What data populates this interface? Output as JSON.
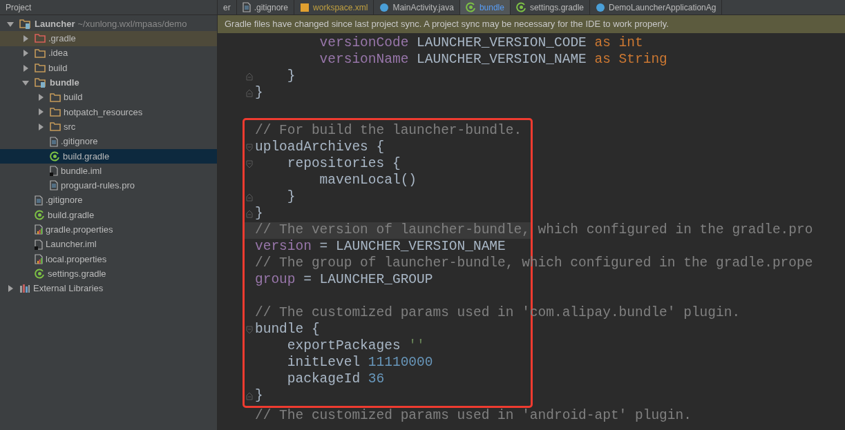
{
  "project_header": {
    "title": "Project"
  },
  "tabs": [
    {
      "label": "er",
      "kind": "none",
      "selected": false
    },
    {
      "label": ".gitignore",
      "kind": "text",
      "selected": false
    },
    {
      "label": "workspace.xml",
      "kind": "xml",
      "selected": false
    },
    {
      "label": "MainActivity.java",
      "kind": "class",
      "selected": false
    },
    {
      "label": "bundle",
      "kind": "gradle",
      "selected": true
    },
    {
      "label": "settings.gradle",
      "kind": "gradle",
      "selected": false
    },
    {
      "label": "DemoLauncherApplicationAg",
      "kind": "class",
      "selected": false
    }
  ],
  "sidebar": {
    "tree": [
      {
        "label": "Launcher",
        "path": "~/xunlong.wxl/mpaas/demo",
        "kind": "module",
        "expanded": true,
        "selected": false,
        "highlighted": false,
        "children": [
          {
            "label": ".gradle",
            "kind": "excluded-folder",
            "expanded": false,
            "selected": false,
            "highlighted": true
          },
          {
            "label": ".idea",
            "kind": "folder",
            "expanded": false,
            "selected": false,
            "highlighted": false
          },
          {
            "label": "build",
            "kind": "folder",
            "expanded": false,
            "selected": false,
            "highlighted": false
          },
          {
            "label": "bundle",
            "kind": "module",
            "expanded": true,
            "selected": false,
            "highlighted": false,
            "children": [
              {
                "label": "build",
                "kind": "folder",
                "expanded": false,
                "selected": false,
                "highlighted": false
              },
              {
                "label": "hotpatch_resources",
                "kind": "folder",
                "expanded": false,
                "selected": false,
                "highlighted": false
              },
              {
                "label": "src",
                "kind": "folder",
                "expanded": false,
                "selected": false,
                "highlighted": false
              },
              {
                "label": ".gitignore",
                "kind": "text",
                "selected": false,
                "highlighted": false
              },
              {
                "label": "build.gradle",
                "kind": "gradle",
                "selected": true,
                "highlighted": false
              },
              {
                "label": "bundle.iml",
                "kind": "iml",
                "selected": false,
                "highlighted": false
              },
              {
                "label": "proguard-rules.pro",
                "kind": "text",
                "selected": false,
                "highlighted": false
              }
            ]
          },
          {
            "label": ".gitignore",
            "kind": "text",
            "selected": false,
            "highlighted": false
          },
          {
            "label": "build.gradle",
            "kind": "gradle",
            "selected": false,
            "highlighted": false
          },
          {
            "label": "gradle.properties",
            "kind": "properties",
            "selected": false,
            "highlighted": false
          },
          {
            "label": "Launcher.iml",
            "kind": "iml",
            "selected": false,
            "highlighted": false
          },
          {
            "label": "local.properties",
            "kind": "properties",
            "selected": false,
            "highlighted": false
          },
          {
            "label": "settings.gradle",
            "kind": "gradle",
            "selected": false,
            "highlighted": false
          }
        ]
      },
      {
        "label": "External Libraries",
        "kind": "library",
        "expanded": false,
        "selected": false,
        "highlighted": false
      }
    ]
  },
  "notification": {
    "text": "Gradle files have changed since last project sync. A project sync may be necessary for the IDE to work properly."
  },
  "editor": {
    "lines_before": [
      {
        "kind": "plain",
        "current": false,
        "tokens": [
          {
            "kind": "property",
            "text": "        versionCode"
          },
          {
            "kind": "plain",
            "text": " LAUNCHER_VERSION_CODE "
          },
          {
            "kind": "keyword",
            "text": "as int"
          }
        ]
      },
      {
        "kind": "plain",
        "current": false,
        "tokens": [
          {
            "kind": "property",
            "text": "        versionName"
          },
          {
            "kind": "plain",
            "text": " LAUNCHER_VERSION_NAME "
          },
          {
            "kind": "keyword",
            "text": "as String"
          }
        ]
      },
      {
        "kind": "fold-end",
        "current": false,
        "tokens": [
          {
            "kind": "plain",
            "text": "    }"
          }
        ]
      },
      {
        "kind": "fold-end",
        "current": false,
        "tokens": [
          {
            "kind": "plain",
            "text": "}"
          }
        ]
      },
      {
        "kind": "plain",
        "current": false
      }
    ],
    "highlighted_lines": [
      {
        "kind": "plain",
        "current": false,
        "tokens": [
          {
            "kind": "comment",
            "text": "// For build the launcher-bundle."
          }
        ]
      },
      {
        "kind": "fold-start",
        "current": false,
        "tokens": [
          {
            "kind": "plain",
            "text": "uploadArchives {"
          }
        ]
      },
      {
        "kind": "fold-start",
        "current": false,
        "tokens": [
          {
            "kind": "plain",
            "text": "    repositories {"
          }
        ]
      },
      {
        "kind": "plain",
        "current": false,
        "tokens": [
          {
            "kind": "plain",
            "text": "        mavenLocal()"
          }
        ]
      },
      {
        "kind": "fold-end",
        "current": false,
        "tokens": [
          {
            "kind": "plain",
            "text": "    }"
          }
        ]
      },
      {
        "kind": "fold-end",
        "current": false,
        "tokens": [
          {
            "kind": "plain",
            "text": "}"
          }
        ]
      },
      {
        "kind": "plain",
        "current": true,
        "tokens": [
          {
            "kind": "comment",
            "text": "// The version of launcher-bundle, which configured in the gradle.pro"
          }
        ]
      },
      {
        "kind": "plain",
        "current": false,
        "tokens": [
          {
            "kind": "property",
            "text": "version"
          },
          {
            "kind": "plain",
            "text": " = LAUNCHER_VERSION_NAME"
          }
        ]
      },
      {
        "kind": "plain",
        "current": false,
        "tokens": [
          {
            "kind": "comment",
            "text": "// The group of launcher-bundle, which configured in the gradle.prope"
          }
        ]
      },
      {
        "kind": "plain",
        "current": false,
        "tokens": [
          {
            "kind": "property",
            "text": "group"
          },
          {
            "kind": "plain",
            "text": " = LAUNCHER_GROUP"
          }
        ]
      },
      {
        "kind": "plain",
        "current": false
      },
      {
        "kind": "plain",
        "current": false,
        "tokens": [
          {
            "kind": "comment",
            "text": "// The customized params used in 'com.alipay.bundle' plugin."
          }
        ]
      },
      {
        "kind": "fold-start",
        "current": false,
        "tokens": [
          {
            "kind": "plain",
            "text": "bundle {"
          }
        ]
      },
      {
        "kind": "plain",
        "current": false,
        "tokens": [
          {
            "kind": "plain",
            "text": "    exportPackages "
          },
          {
            "kind": "string",
            "text": "''"
          }
        ]
      },
      {
        "kind": "plain",
        "current": false,
        "tokens": [
          {
            "kind": "plain",
            "text": "    initLevel "
          },
          {
            "kind": "number",
            "text": "11110000"
          }
        ]
      },
      {
        "kind": "plain",
        "current": false,
        "tokens": [
          {
            "kind": "plain",
            "text": "    packageId "
          },
          {
            "kind": "number",
            "text": "36"
          }
        ]
      },
      {
        "kind": "fold-end",
        "current": false,
        "tokens": [
          {
            "kind": "plain",
            "text": "}"
          }
        ]
      }
    ],
    "lines_after": [
      {
        "current": false,
        "tokens": [
          {
            "kind": "comment",
            "text": "// The customized params used in 'android-apt' plugin."
          }
        ]
      }
    ]
  }
}
